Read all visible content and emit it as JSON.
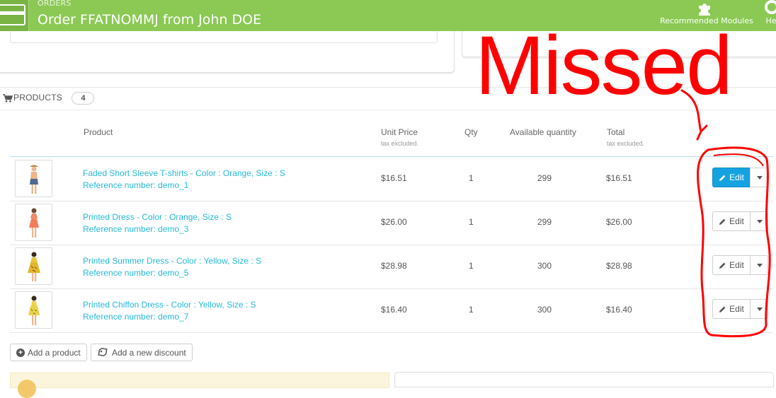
{
  "header": {
    "breadcrumb": "ORDERS",
    "title": "Order FFATNOMMJ from John DOE",
    "buttons": [
      {
        "label": "Recommended Modules",
        "icon": "puzzle-icon"
      },
      {
        "label": "He",
        "icon": "lifebuoy-icon"
      }
    ]
  },
  "products": {
    "heading": "PRODUCTS",
    "count": "4",
    "columns": {
      "product": "Product",
      "unit_price": "Unit Price",
      "unit_price_note": "tax excluded.",
      "qty": "Qty",
      "available": "Available quantity",
      "total": "Total",
      "total_note": "tax excluded."
    },
    "rows": [
      {
        "name": "Faded Short Sleeve T-shirts - Color : Orange, Size : S",
        "ref": "Reference number: demo_1",
        "unit_price": "$16.51",
        "qty": "1",
        "available": "299",
        "total": "$16.51",
        "edit": "Edit",
        "active": true
      },
      {
        "name": "Printed Dress - Color : Orange, Size : S",
        "ref": "Reference number: demo_3",
        "unit_price": "$26.00",
        "qty": "1",
        "available": "299",
        "total": "$26.00",
        "edit": "Edit",
        "active": false
      },
      {
        "name": "Printed Summer Dress - Color : Yellow, Size : S",
        "ref": "Reference number: demo_5",
        "unit_price": "$28.98",
        "qty": "1",
        "available": "300",
        "total": "$28.98",
        "edit": "Edit",
        "active": false
      },
      {
        "name": "Printed Chiffon Dress - Color : Yellow, Size : S",
        "ref": "Reference number: demo_7",
        "unit_price": "$16.40",
        "qty": "1",
        "available": "300",
        "total": "$16.40",
        "edit": "Edit",
        "active": false
      }
    ],
    "add_product": "Add a product",
    "add_discount": "Add a new discount"
  },
  "annotation": {
    "text": "Missed",
    "color": "#ff0000"
  },
  "colors": {
    "header": "#8bc954",
    "link": "#25b9d7",
    "active_button": "#14a3e0"
  }
}
